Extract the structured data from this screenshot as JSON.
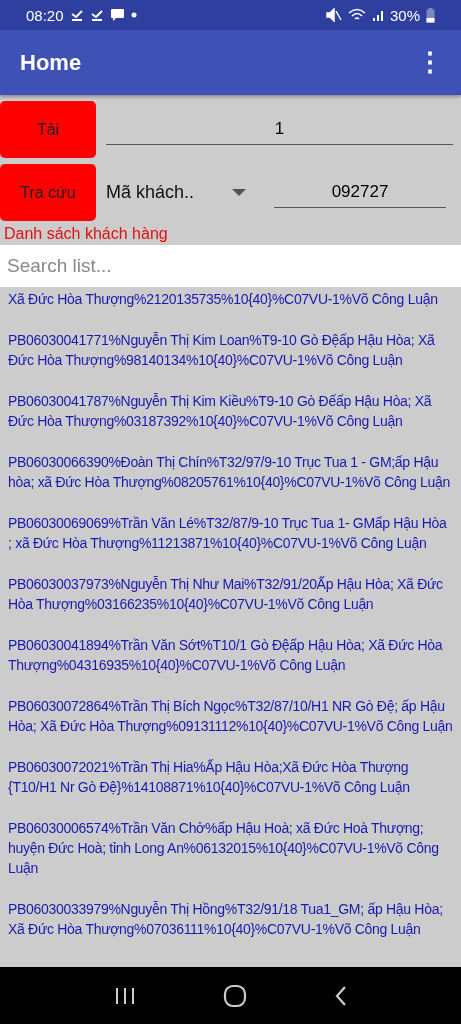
{
  "status_bar": {
    "time": "08:20",
    "battery": "30%"
  },
  "app_bar": {
    "title": "Home",
    "menu_icon": "⋮"
  },
  "load": {
    "button": "Tải",
    "value": "1"
  },
  "lookup": {
    "button": "Tra cứu",
    "field": "Mã khách..",
    "value": "092727"
  },
  "list_title": "Danh sách khách hàng",
  "search": {
    "placeholder": "Search list..."
  },
  "customers": [
    "Xã Đức Hòa Thượng%2120135735%10{40}%C07VU-1%Võ Công Luận",
    "PB06030041771%Nguyễn Thị Kim Loan%T9-10 Gò Đệấp Hậu Hòa; Xã Đức Hòa Thượng%98140134%10{40}%C07VU-1%Võ Công Luận",
    "PB06030041787%Nguyễn Thị Kim Kiều%T9-10 Gò Đếấp Hậu Hòa; Xã Đức Hòa Thượng%03187392%10{40}%C07VU-1%Võ Công Luận",
    "PB06030066390%Đoàn Thị Chín%T32/97/9-10 Trục Tua 1 - GM;ấp Hậu hòa; xã Đức Hòa Thượng%08205761%10{40}%C07VU-1%Võ Công Luận",
    "PB06030069069%Trần Văn Lé%T32/87/9-10 Trục Tua 1- GMấp Hậu Hòa ; xã Đức Hòa Thượng%11213871%10{40}%C07VU-1%Võ Công Luận",
    "PB06030037973%Nguyễn Thị Như Mai%T32/91/20Ấp Hậu Hòa; Xã Đức Hòa Thượng%03166235%10{40}%C07VU-1%Võ Công Luận",
    "PB06030041894%Trần Văn Sớt%T10/1 Gò Đệấp Hậu Hòa; Xã Đức Hòa Thượng%04316935%10{40}%C07VU-1%Võ Công Luận",
    "PB06030072864%Trần Thị Bích Ngọc%T32/87/10/H1 NR Gò Đệ; ấp Hậu Hòa; Xã Đức Hòa Thượng%09131112%10{40}%C07VU-1%Võ Công Luận",
    "PB06030072021%Trần Thị Hia%Ấp Hậu Hòa;Xã Đức Hòa Thượng {T10/H1 Nr Gò Đệ}%14108871%10{40}%C07VU-1%Võ Công Luận",
    "PB06030006574%Trần Văn Chở%ấp Hậu Hoà; xã Đức Hoà Thượng; huyện Đức Hoà; tỉnh Long An%06132015%10{40}%C07VU-1%Võ Công Luận",
    "PB06030033979%Nguyễn Thị Hồng%T32/91/18 Tua1_GM; ấp Hậu Hòa; Xã Đức Hòa Thượng%07036111%10{40}%C07VU-1%Võ Công Luận"
  ]
}
